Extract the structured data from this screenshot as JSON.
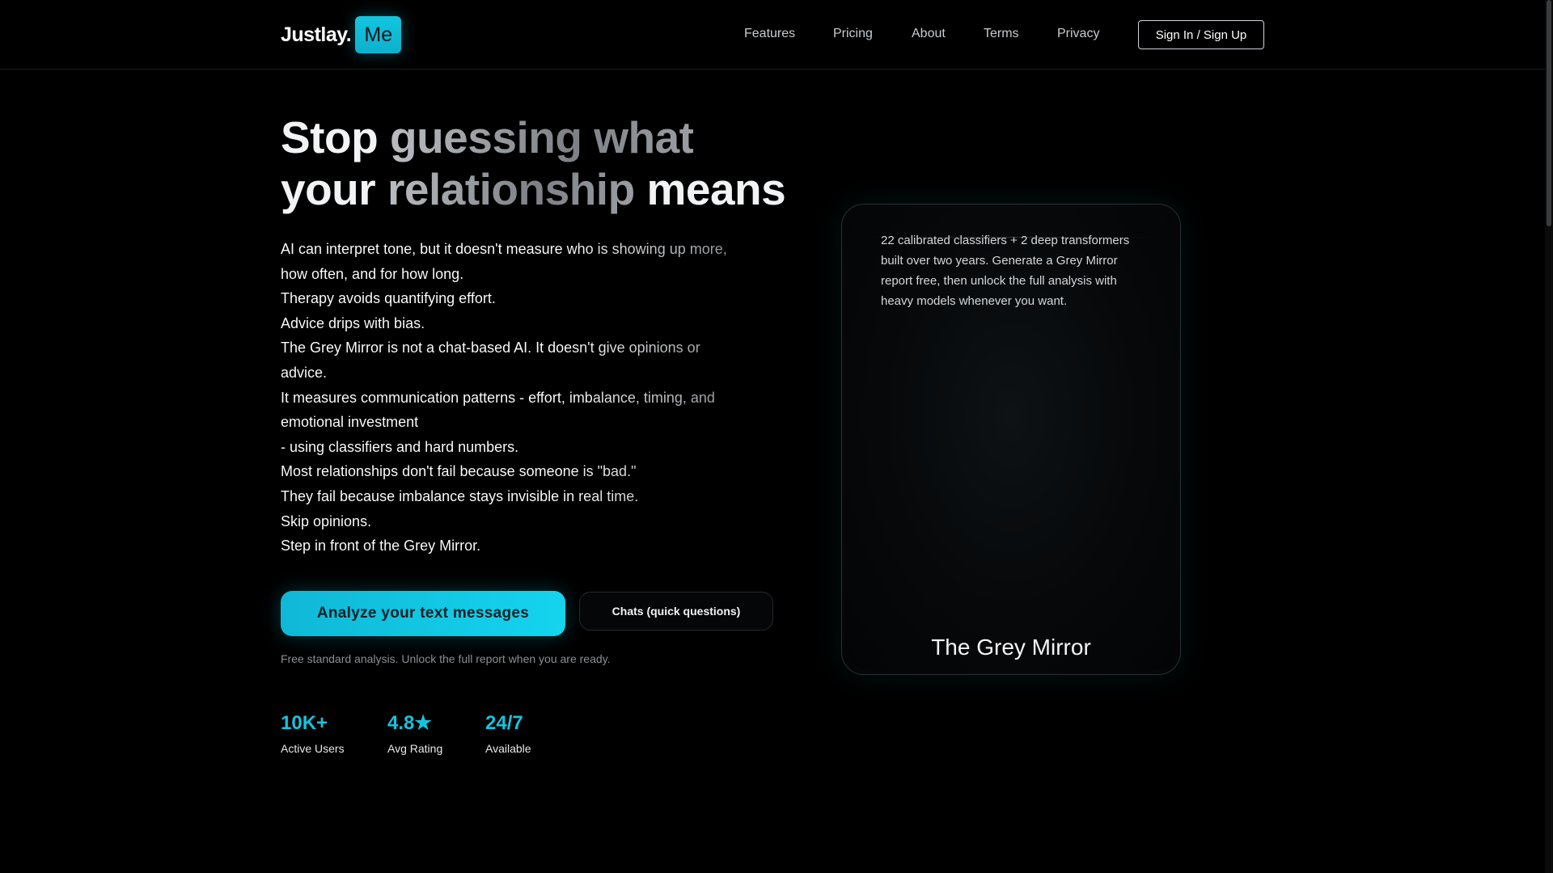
{
  "nav": {
    "logo_text": "Justlay.",
    "logo_badge": "Me",
    "links": [
      {
        "label": "Features"
      },
      {
        "label": "Pricing"
      },
      {
        "label": "About"
      },
      {
        "label": "Terms"
      },
      {
        "label": "Privacy"
      }
    ],
    "signin_label": "Sign In / Sign Up"
  },
  "hero": {
    "title_line1_a": "Stop ",
    "title_line1_b": "guessing what",
    "title_line2_a": "your ",
    "title_line2_b": "relationship",
    "title_line2_c": " means",
    "body": [
      "AI can interpret tone, but it doesn't measure who is showing up more, how often, and for how long.",
      "Therapy avoids quantifying effort.",
      "Advice drips with bias.",
      "The Grey Mirror is not a chat-based AI. It doesn't give opinions or advice.",
      "It measures communication patterns - effort, imbalance, timing, and emotional investment",
      "- using classifiers and hard numbers.",
      "Most relationships don't fail because someone is \"bad.\"",
      "They fail because imbalance stays invisible in real time.",
      "Skip opinions.",
      "Step in front of the Grey Mirror."
    ],
    "cta_primary": "Analyze your text messages",
    "cta_secondary": "Chats (quick questions)",
    "note": "Free standard analysis. Unlock the full report when you are ready."
  },
  "stats": [
    {
      "value": "10K+",
      "label": "Active Users"
    },
    {
      "value": "4.8★",
      "label": "Avg Rating"
    },
    {
      "value": "24/7",
      "label": "Available"
    }
  ],
  "card": {
    "description": "22 calibrated classifiers + 2 deep transformers built over two years. Generate a Grey Mirror report free, then unlock the full analysis with heavy models whenever you want.",
    "title": "The Grey Mirror"
  },
  "colors": {
    "accent": "#16c3de",
    "background": "#000000"
  }
}
